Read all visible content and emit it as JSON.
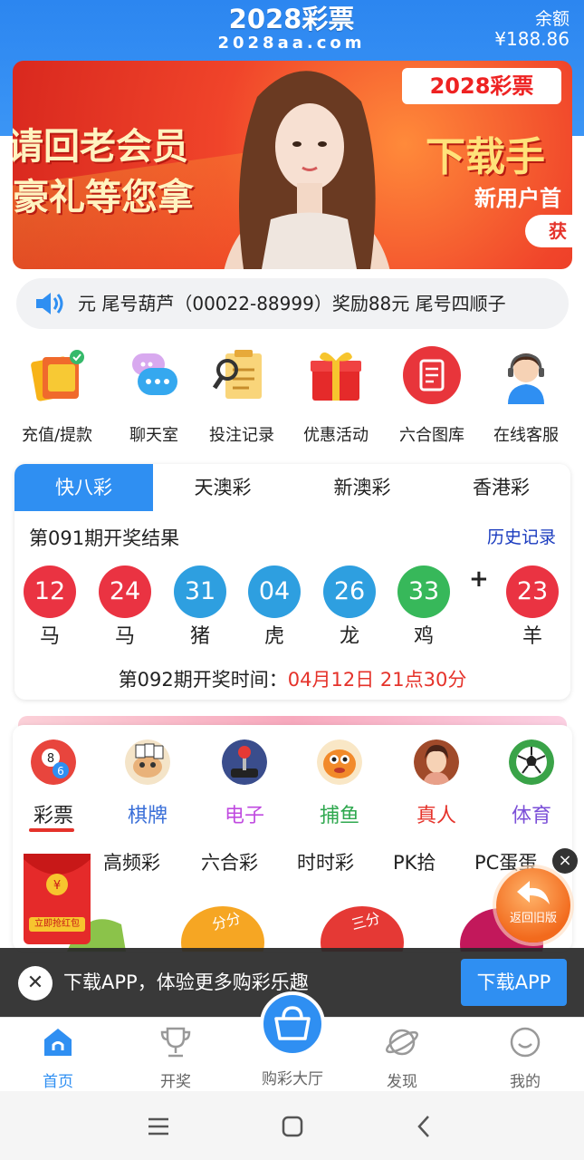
{
  "header": {
    "logo_main": "2028彩票",
    "logo_sub": "2028aa.com",
    "balance_label": "余额",
    "balance_value": "¥188.86"
  },
  "banner": {
    "left_line1": "请回老会员",
    "left_line2": "豪礼等您拿",
    "right_line1": "下载手",
    "right_line2": "新用户首",
    "button": "获",
    "logo_text": "2028彩票",
    "active_slide": 2,
    "slide_count": 2
  },
  "notice": {
    "text": "元 尾号葫芦（00022-88999）奖励88元 尾号四顺子"
  },
  "quick_menu": [
    {
      "label": "充值/提款",
      "icon": "wallet-icon"
    },
    {
      "label": "聊天室",
      "icon": "chat-icon"
    },
    {
      "label": "投注记录",
      "icon": "record-icon"
    },
    {
      "label": "优惠活动",
      "icon": "gift-icon"
    },
    {
      "label": "六合图库",
      "icon": "gallery-icon"
    },
    {
      "label": "在线客服",
      "icon": "service-icon"
    }
  ],
  "lottery": {
    "tabs": [
      "快八彩",
      "天澳彩",
      "新澳彩",
      "香港彩"
    ],
    "active_tab": 0,
    "issue_title": "第091期开奖结果",
    "history_link": "历史记录",
    "balls": [
      {
        "num": "12",
        "zodiac": "马",
        "color": "#ea3342"
      },
      {
        "num": "24",
        "zodiac": "马",
        "color": "#ea3342"
      },
      {
        "num": "31",
        "zodiac": "猪",
        "color": "#2e9fe0"
      },
      {
        "num": "04",
        "zodiac": "虎",
        "color": "#2e9fe0"
      },
      {
        "num": "26",
        "zodiac": "龙",
        "color": "#2e9fe0"
      },
      {
        "num": "33",
        "zodiac": "鸡",
        "color": "#37b85a"
      }
    ],
    "plus": "+",
    "special": {
      "num": "23",
      "zodiac": "羊",
      "color": "#ea3342"
    },
    "next_prefix": "第092期开奖时间：",
    "next_time": "04月12日 21点30分"
  },
  "categories": [
    {
      "label": "彩票",
      "color": "#222222",
      "icon": "lottery-ball-icon"
    },
    {
      "label": "棋牌",
      "color": "#3a6fd8",
      "icon": "cards-icon"
    },
    {
      "label": "电子",
      "color": "#c04be0",
      "icon": "joystick-icon"
    },
    {
      "label": "捕鱼",
      "color": "#2fa84f",
      "icon": "fish-icon"
    },
    {
      "label": "真人",
      "color": "#e5322a",
      "icon": "dealer-icon"
    },
    {
      "label": "体育",
      "color": "#7b4fd8",
      "icon": "soccer-icon"
    }
  ],
  "subtabs": [
    "高频彩",
    "六合彩",
    "时时彩",
    "PK拾",
    "PC蛋蛋"
  ],
  "envelope_label": "立即抢红包",
  "return_old": "返回旧版",
  "download": {
    "text": "下载APP，体验更多购彩乐趣",
    "button": "下载APP"
  },
  "nav": [
    {
      "label": "首页",
      "icon": "home-icon"
    },
    {
      "label": "开奖",
      "icon": "trophy-icon"
    },
    {
      "label": "购彩大厅",
      "icon": "basket-icon"
    },
    {
      "label": "发现",
      "icon": "planet-icon"
    },
    {
      "label": "我的",
      "icon": "smile-icon"
    }
  ],
  "colors": {
    "brand_blue": "#2f8ff2",
    "accent_red": "#e5322a",
    "history_link": "#1a3bbf"
  }
}
